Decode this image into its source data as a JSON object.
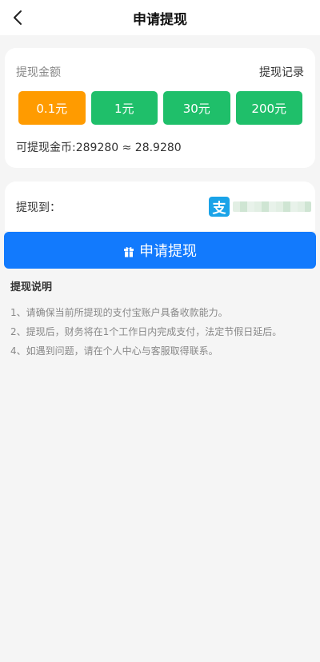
{
  "header": {
    "title": "申请提现",
    "back_icon": "chevron-left-icon"
  },
  "withdraw": {
    "amount_label": "提现金额",
    "record_link": "提现记录",
    "amounts": [
      {
        "label": "0.1元",
        "selected": true
      },
      {
        "label": "1元",
        "selected": false
      },
      {
        "label": "30元",
        "selected": false
      },
      {
        "label": "200元",
        "selected": false
      }
    ],
    "balance_text": "可提现金币:289280 ≈ 28.9280"
  },
  "target": {
    "label": "提现到：",
    "method_icon": "alipay-icon",
    "method_glyph": "支"
  },
  "submit": {
    "label": "申请提现",
    "icon": "gift-icon"
  },
  "notes": {
    "title": "提现说明",
    "items": [
      "1、请确保当前所提现的支付宝账户具备收款能力。",
      "2、提现后，财务将在1个工作日内完成支付，法定节假日延后。",
      "4、如遇到问题，请在个人中心与客服取得联系。"
    ]
  },
  "colors": {
    "selected_amount": "#ff9b00",
    "amount_button": "#1fbf6a",
    "primary_button": "#127afd",
    "alipay_blue": "#1aa3e8",
    "page_background": "#f5f5f5"
  }
}
